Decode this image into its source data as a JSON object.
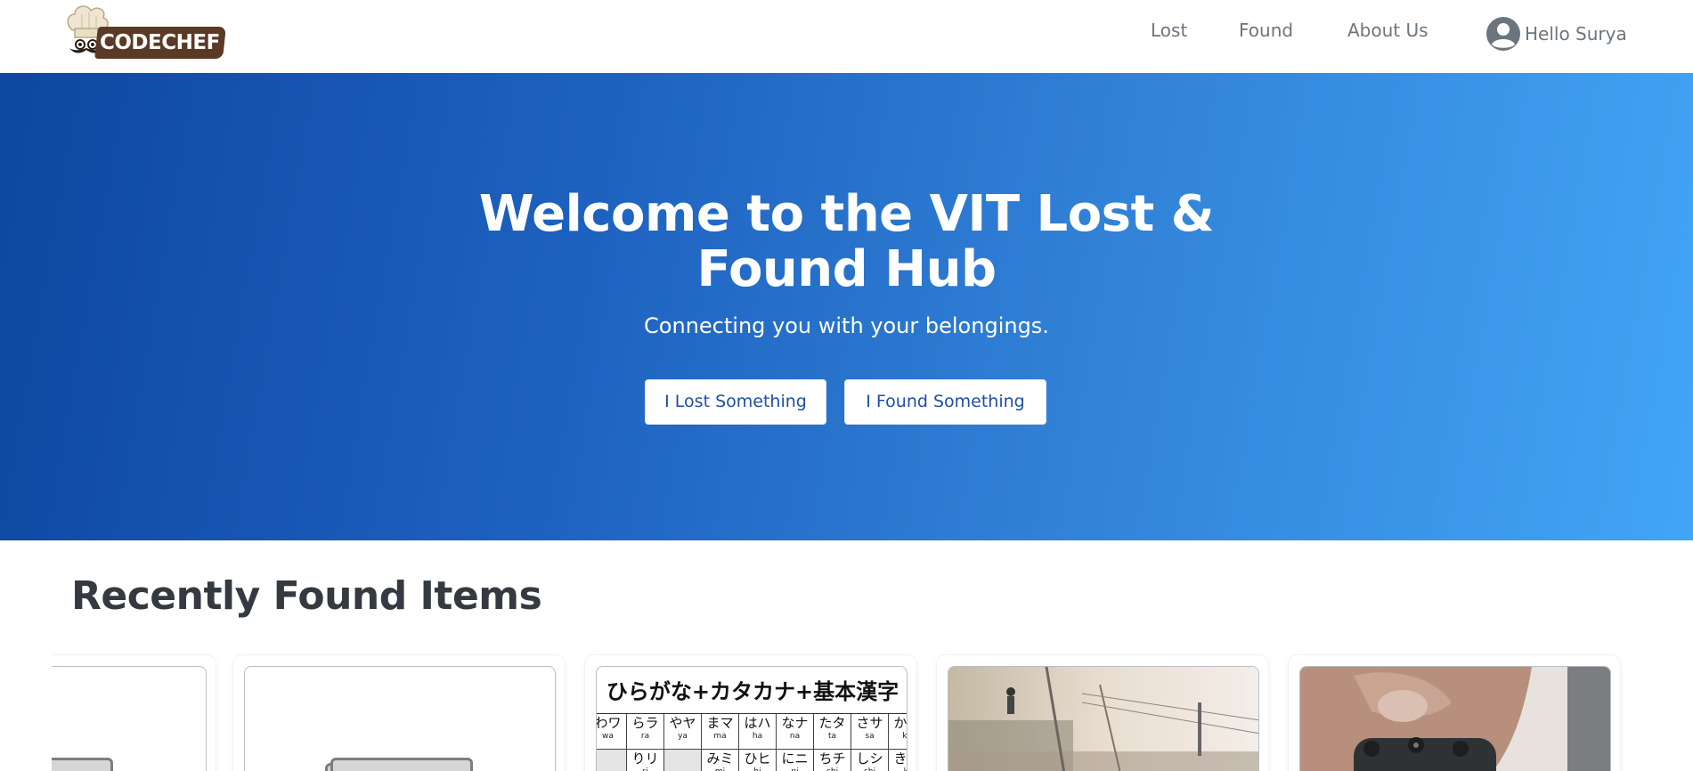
{
  "brand": {
    "logo_text": "CODECHEF"
  },
  "nav": {
    "links": [
      {
        "label": "Lost"
      },
      {
        "label": "Found"
      },
      {
        "label": "About Us"
      }
    ],
    "user_greeting": "Hello Surya"
  },
  "hero": {
    "title_line1": "Welcome to the VIT Lost &",
    "title_line2": "Found Hub",
    "subtitle": "Connecting you with your belongings.",
    "btn_lost": "I Lost Something",
    "btn_found": "I Found Something"
  },
  "recent": {
    "title": "Recently Found Items",
    "cards": [
      {
        "image": "placeholder-image"
      },
      {
        "image": "placeholder-image"
      },
      {
        "image": "japanese-kana-chart"
      },
      {
        "image": "outdoor-photo"
      },
      {
        "image": "watch-photo"
      }
    ],
    "jp_chart": {
      "title": "ひらがな+カタカナ+基本漢字",
      "row1": [
        {
          "k": "わワ",
          "r": "wa"
        },
        {
          "k": "らラ",
          "r": "ra"
        },
        {
          "k": "やヤ",
          "r": "ya"
        },
        {
          "k": "まマ",
          "r": "ma"
        },
        {
          "k": "はハ",
          "r": "ha"
        },
        {
          "k": "なナ",
          "r": "na"
        },
        {
          "k": "たタ",
          "r": "ta"
        },
        {
          "k": "さサ",
          "r": "sa"
        },
        {
          "k": "かカ",
          "r": "ka"
        }
      ],
      "row2": [
        {
          "k": "",
          "r": ""
        },
        {
          "k": "りリ",
          "r": "ri"
        },
        {
          "k": "",
          "r": ""
        },
        {
          "k": "みミ",
          "r": "mi"
        },
        {
          "k": "ひヒ",
          "r": "hi"
        },
        {
          "k": "にニ",
          "r": "ni"
        },
        {
          "k": "ちチ",
          "r": "chi"
        },
        {
          "k": "しシ",
          "r": "shi"
        },
        {
          "k": "きキ",
          "r": "ki"
        }
      ]
    }
  },
  "colors": {
    "hero_gradient_start": "#0d47a1",
    "hero_gradient_end": "#42a5f5",
    "button_text": "#1d4fa3",
    "nav_text": "#6c757d",
    "heading": "#343a40",
    "logo_bg": "#5b3a25"
  }
}
